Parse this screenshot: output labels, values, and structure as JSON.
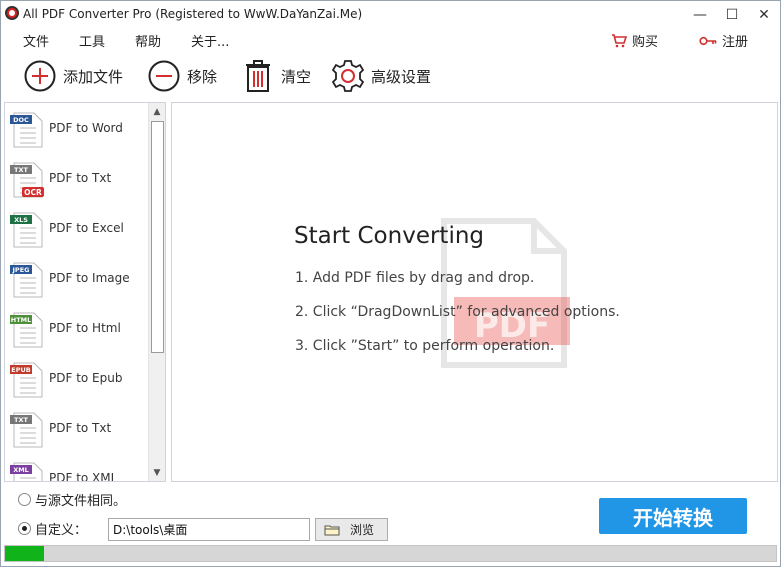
{
  "window": {
    "title": "All PDF Converter Pro (Registered to WwW.DaYanZai.Me)",
    "controls": {
      "minimize": "—",
      "maximize": "☐",
      "close": "✕"
    }
  },
  "menu": {
    "file": "文件",
    "tools": "工具",
    "help": "帮助",
    "about": "关于...",
    "buy": "购买",
    "register": "注册"
  },
  "toolbar": {
    "add_files": "添加文件",
    "remove": "移除",
    "clear": "清空",
    "advanced_settings": "高级设置"
  },
  "sidebar": {
    "items": [
      {
        "label": "PDF to Word",
        "badge": "DOC",
        "badge_color": "#2b5797"
      },
      {
        "label": "PDF to Txt",
        "badge": "TXT",
        "badge_color": "#777777",
        "extra": "OCR"
      },
      {
        "label": "PDF to Excel",
        "badge": "XLS",
        "badge_color": "#1e7145"
      },
      {
        "label": "PDF to Image",
        "badge": "JPEG",
        "badge_color": "#2b5797"
      },
      {
        "label": "PDF to Html",
        "badge": "HTML",
        "badge_color": "#4e8f3a"
      },
      {
        "label": "PDF to Epub",
        "badge": "EPUB",
        "badge_color": "#c0392b"
      },
      {
        "label": "PDF to Txt",
        "badge": "TXT",
        "badge_color": "#777777"
      },
      {
        "label": "PDF to XML",
        "badge": "XML",
        "badge_color": "#7b3fa0"
      }
    ]
  },
  "main": {
    "title": "Start Converting",
    "steps": [
      "1. Add PDF files by drag and drop.",
      "2. Click “DragDownList” for advanced options.",
      "3. Click ”Start” to perform operation."
    ],
    "watermark_text": "PDF"
  },
  "output": {
    "same_as_source": "与源文件相同。",
    "custom": "自定义：",
    "path": "D:\\tools\\桌面",
    "browse": "浏览",
    "selected": "custom"
  },
  "start_button": "开始转换",
  "progress": {
    "percent": 5
  },
  "colors": {
    "accent": "#2196e6",
    "progress": "#11b31b",
    "watermark_red": "#e53935"
  }
}
